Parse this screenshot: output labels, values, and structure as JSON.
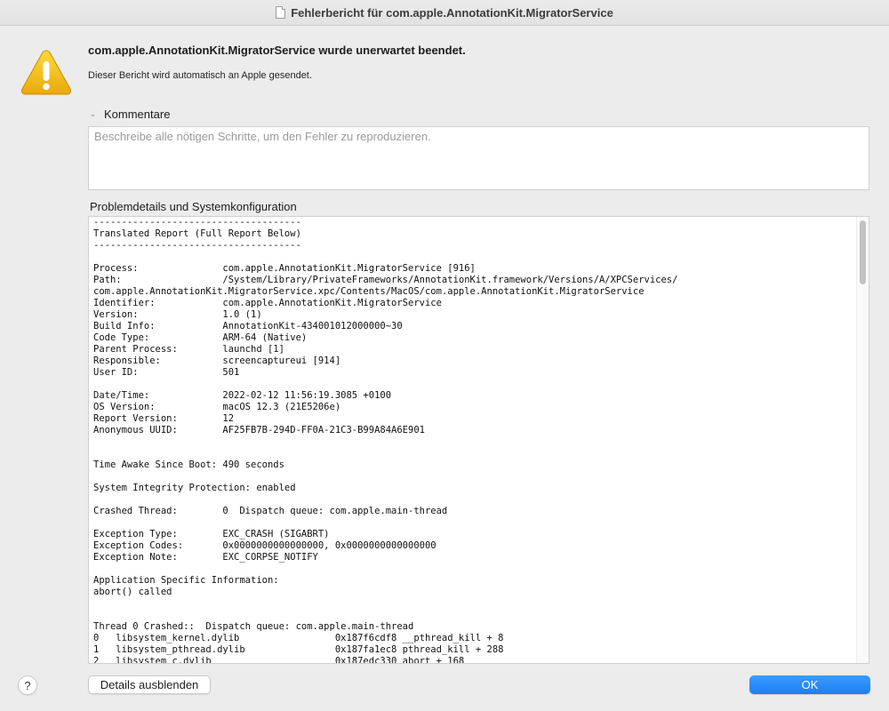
{
  "window": {
    "title": "Fehlerbericht für com.apple.AnnotationKit.MigratorService",
    "title_icon": "document-icon"
  },
  "alert": {
    "icon": "warning-icon",
    "icon_color": "#f5c518",
    "headline": "com.apple.AnnotationKit.MigratorService wurde unerwartet beendet.",
    "subline": "Dieser Bericht wird automatisch an Apple gesendet."
  },
  "comments": {
    "label": "Kommentare",
    "expanded": true,
    "placeholder": "Beschreibe alle nötigen Schritte, um den Fehler zu reproduzieren.",
    "value": ""
  },
  "details": {
    "label": "Problemdetails und Systemkonfiguration",
    "report_lines": [
      "-------------------------------------",
      "Translated Report (Full Report Below)",
      "-------------------------------------",
      "",
      "Process:               com.apple.AnnotationKit.MigratorService [916]",
      "Path:                  /System/Library/PrivateFrameworks/AnnotationKit.framework/Versions/A/XPCServices/",
      "com.apple.AnnotationKit.MigratorService.xpc/Contents/MacOS/com.apple.AnnotationKit.MigratorService",
      "Identifier:            com.apple.AnnotationKit.MigratorService",
      "Version:               1.0 (1)",
      "Build Info:            AnnotationKit-434001012000000~30",
      "Code Type:             ARM-64 (Native)",
      "Parent Process:        launchd [1]",
      "Responsible:           screencaptureui [914]",
      "User ID:               501",
      "",
      "Date/Time:             2022-02-12 11:56:19.3085 +0100",
      "OS Version:            macOS 12.3 (21E5206e)",
      "Report Version:        12",
      "Anonymous UUID:        AF25FB7B-294D-FF0A-21C3-B99A84A6E901",
      "",
      "",
      "Time Awake Since Boot: 490 seconds",
      "",
      "System Integrity Protection: enabled",
      "",
      "Crashed Thread:        0  Dispatch queue: com.apple.main-thread",
      "",
      "Exception Type:        EXC_CRASH (SIGABRT)",
      "Exception Codes:       0x0000000000000000, 0x0000000000000000",
      "Exception Note:        EXC_CORPSE_NOTIFY",
      "",
      "Application Specific Information:",
      "abort() called",
      "",
      "",
      "Thread 0 Crashed::  Dispatch queue: com.apple.main-thread",
      "0   libsystem_kernel.dylib                 0x187f6cdf8 __pthread_kill + 8",
      "1   libsystem_pthread.dylib                0x187fa1ec8 pthread_kill + 288",
      "2   libsystem_c.dylib                      0x187edc330 abort + 168"
    ]
  },
  "buttons": {
    "help": "?",
    "details_toggle": "Details ausblenden",
    "ok": "OK",
    "ok_color": "#1a7ff6"
  }
}
